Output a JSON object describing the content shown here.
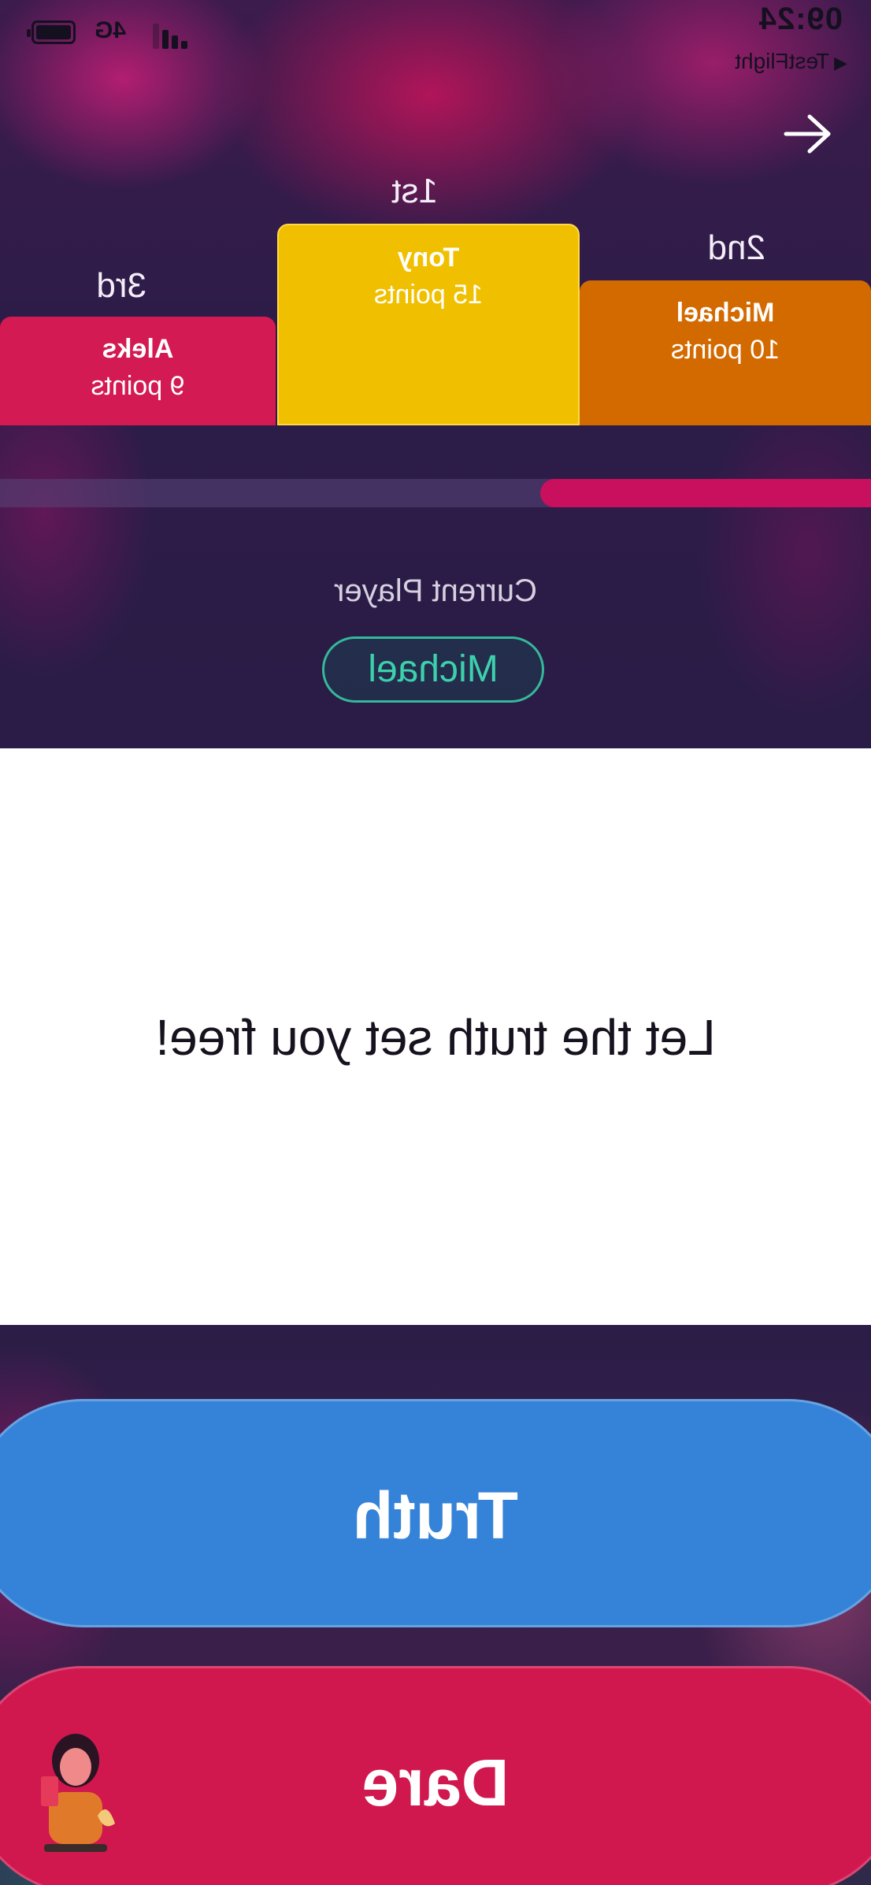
{
  "status_bar": {
    "time": "09:24",
    "back_app": "TestFlight",
    "network": "4G"
  },
  "leaderboard": [
    {
      "rank": "1st",
      "name": "Tony",
      "points": "15 points",
      "color": "#f0c000"
    },
    {
      "rank": "2nd",
      "name": "Michael",
      "points": "10 points",
      "color": "#d36a00"
    },
    {
      "rank": "3rd",
      "name": "Aleks",
      "points": "9 points",
      "color": "#d41a52"
    }
  ],
  "progress": {
    "fraction": 0.38,
    "color": "#c8105e"
  },
  "current_player": {
    "label": "Current Player",
    "name": "Michael"
  },
  "card": {
    "text": "Let the truth set you free!"
  },
  "actions": {
    "truth_label": "Truth",
    "dare_label": "Dare"
  },
  "colors": {
    "truth": "#3583d8",
    "dare": "#d0184f",
    "accent_green": "#3cd0ac"
  }
}
